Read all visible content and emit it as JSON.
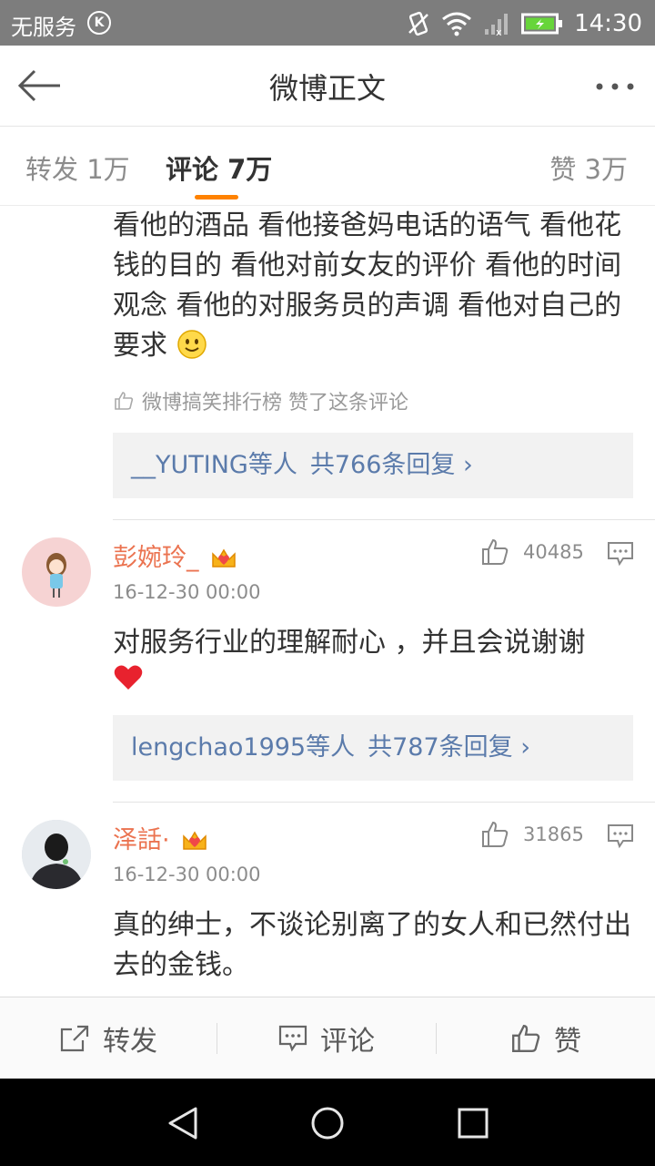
{
  "status_bar": {
    "carrier": "无服务",
    "time": "14:30"
  },
  "nav": {
    "title": "微博正文"
  },
  "tabs": [
    {
      "label": "转发 1万"
    },
    {
      "label": "评论 7万"
    },
    {
      "label": "赞 3万"
    }
  ],
  "top_comment": {
    "text": "看他的酒品 看他接爸妈电话的语气 看他花钱的目的 看他对前女友的评价 看他的时间观念 看他的对服务员的声调 看他对自己的要求",
    "liked_by": "微博搞笑排行榜 赞了这条评论",
    "reply_users": "__YUTING等人",
    "reply_count": "共766条回复 ›"
  },
  "comments": [
    {
      "name": "彭婉玲_",
      "likes": "40485",
      "date": "16-12-30 00:00",
      "text": "对服务行业的理解耐心 ，并且会说谢谢",
      "reply_users": "lengchao1995等人",
      "reply_count": "共787条回复 ›"
    },
    {
      "name": "泽話·",
      "likes": "31865",
      "date": "16-12-30 00:00",
      "text": "真的绅士，不谈论别离了的女人和已然付出去的金钱。"
    }
  ],
  "bottom_bar": {
    "forward": "转发",
    "comment": "评论",
    "like": "赞"
  },
  "colors": {
    "accent": "#ff8200",
    "username": "#eb7350",
    "link": "#5b7bab"
  }
}
